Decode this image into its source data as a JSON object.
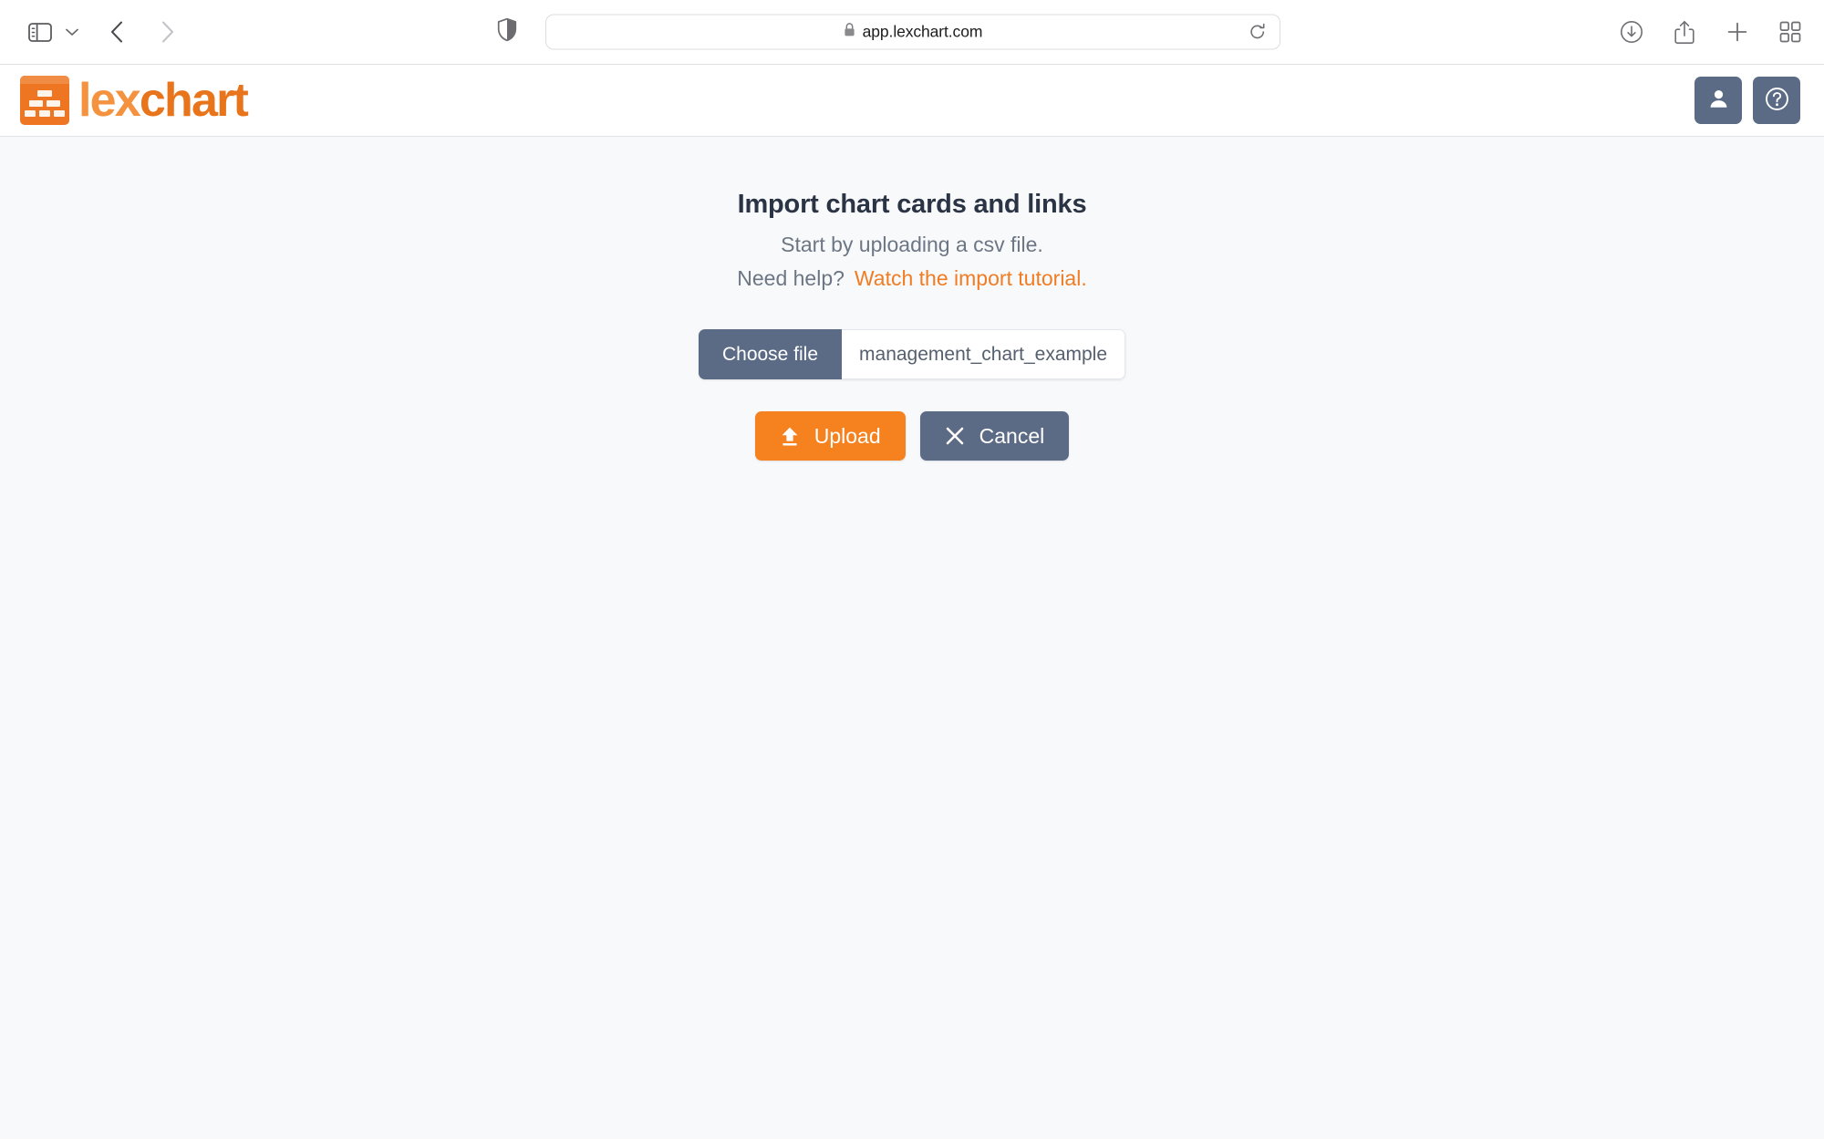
{
  "browser": {
    "url": "app.lexchart.com",
    "icons": {
      "sidebar_toggle": "sidebar-toggle-icon",
      "sidebar_dropdown": "chevron-down-icon",
      "back": "chevron-left-icon",
      "forward": "chevron-right-icon",
      "privacy_shield": "shield-icon",
      "lock": "lock-icon",
      "reload": "reload-icon",
      "downloads": "download-icon",
      "share": "share-icon",
      "new_tab": "plus-icon",
      "tab_overview": "tab-overview-icon"
    }
  },
  "app_header": {
    "brand_part1": "lex",
    "brand_part2": "chart",
    "logo_icon": "org-chart-logo-icon",
    "account_button_icon": "user-icon",
    "help_button_icon": "help-circle-icon",
    "button_color": "#5c6b85"
  },
  "import": {
    "title": "Import chart cards and links",
    "subtitle": "Start by uploading a csv file.",
    "help_prompt": "Need help?",
    "tutorial_link": "Watch the import tutorial.",
    "tutorial_link_color": "#f07c23",
    "choose_file_label": "Choose file",
    "file_name": "management_chart_example",
    "upload_label": "Upload",
    "upload_icon": "upload-arrow-icon",
    "upload_color": "#f5821f",
    "cancel_label": "Cancel",
    "cancel_icon": "close-x-icon",
    "cancel_color": "#5c6b85"
  },
  "theme": {
    "page_background": "#f8f9fb",
    "brand_orange": "#ee7623",
    "brand_orange_light": "#f59240",
    "heading_color": "#2b3445",
    "body_text_color": "#6c7684"
  }
}
